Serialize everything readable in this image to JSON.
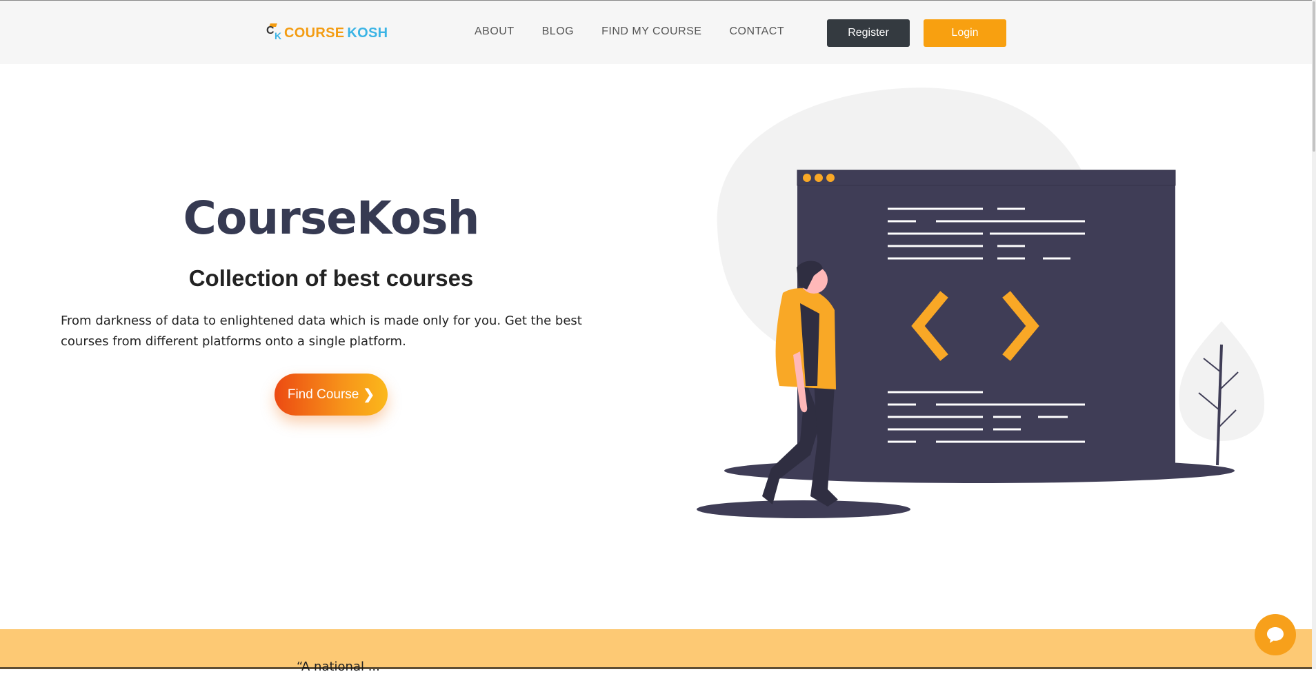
{
  "header": {
    "logo": {
      "text_part1": "COURSE",
      "text_part2": "KOSH",
      "mark_c": "C",
      "mark_k": "K"
    },
    "nav": [
      "ABOUT",
      "BLOG",
      "FIND MY COURSE",
      "CONTACT"
    ],
    "register_label": "Register",
    "login_label": "Login"
  },
  "hero": {
    "title": "CourseKosh",
    "subtitle": "Collection of best courses",
    "description": "From darkness of data to enlightened data which is made only for you. Get the best courses from different platforms onto a single platform.",
    "cta_label": "Find Course",
    "cta_icon": "chevron-right-icon"
  },
  "banner": {
    "quote_fragment": "“A national ... "
  },
  "colors": {
    "accent": "#f8a010",
    "dark": "#343a40",
    "title": "#363a52",
    "banner": "#fdc974",
    "illustration_screen": "#3f3d56"
  }
}
